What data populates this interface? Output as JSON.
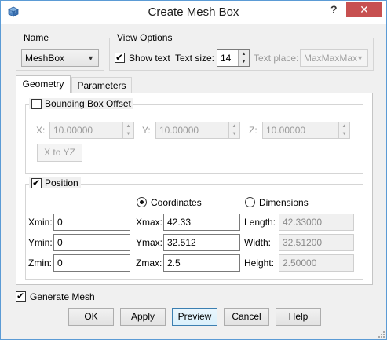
{
  "window": {
    "title": "Create Mesh Box",
    "help_label": "?",
    "close_label": "✕"
  },
  "name_group": {
    "title": "Name",
    "value": "MeshBox"
  },
  "view_options": {
    "title": "View Options",
    "show_text_label": "Show text",
    "show_text_checked": true,
    "text_size_label": "Text size:",
    "text_size_value": "14",
    "text_place_label": "Text place:",
    "text_place_value": "MaxMaxMax"
  },
  "tabs": [
    {
      "label": "Geometry",
      "active": true
    },
    {
      "label": "Parameters",
      "active": false
    }
  ],
  "bounding_box": {
    "title": "Bounding Box Offset",
    "checked": false,
    "x_label": "X:",
    "x_value": "10.00000",
    "y_label": "Y:",
    "y_value": "10.00000",
    "z_label": "Z:",
    "z_value": "10.00000",
    "x_to_yz_label": "X to YZ"
  },
  "position": {
    "title": "Position",
    "checked": true,
    "coordinates_label": "Coordinates",
    "dimensions_label": "Dimensions",
    "selected_mode": "Coordinates",
    "xmin_label": "Xmin:",
    "xmin_value": "0",
    "ymin_label": "Ymin:",
    "ymin_value": "0",
    "zmin_label": "Zmin:",
    "zmin_value": "0",
    "xmax_label": "Xmax:",
    "xmax_value": "42.33",
    "ymax_label": "Ymax:",
    "ymax_value": "32.512",
    "zmax_label": "Zmax:",
    "zmax_value": "2.5",
    "length_label": "Length:",
    "length_value": "42.33000",
    "width_label": "Width:",
    "width_value": "32.51200",
    "height_label": "Height:",
    "height_value": "2.50000"
  },
  "generate_mesh": {
    "label": "Generate Mesh",
    "checked": true
  },
  "buttons": {
    "ok": "OK",
    "apply": "Apply",
    "preview": "Preview",
    "cancel": "Cancel",
    "help": "Help"
  },
  "colors": {
    "close_button": "#c75050",
    "window_border": "#5b9bd5",
    "focus_button_border": "#3c7fb1"
  },
  "icons": {
    "app": "mesh-box-app-icon",
    "close": "close-icon",
    "dropdown": "chevron-down-icon",
    "spin_up": "spin-up-icon",
    "spin_down": "spin-down-icon",
    "resize": "resize-grip-icon"
  }
}
